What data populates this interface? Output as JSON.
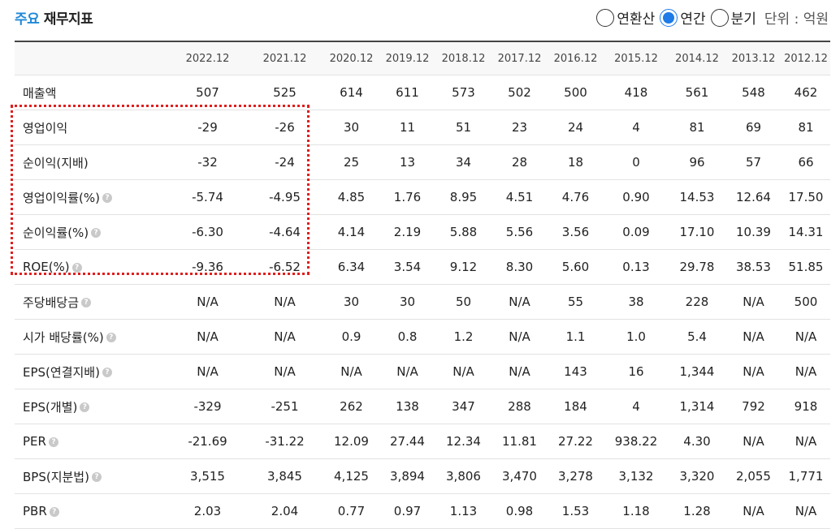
{
  "title": {
    "accent": "주요",
    "main": "재무지표"
  },
  "controls": {
    "options": [
      {
        "label": "연환산",
        "selected": false
      },
      {
        "label": "연간",
        "selected": true
      },
      {
        "label": "분기",
        "selected": false
      }
    ],
    "unit": "단위 : 억원"
  },
  "colors": {
    "accent": "#1e88d8",
    "radio_selected": "#1e7be8",
    "highlight": "#e01e1e"
  },
  "table": {
    "columns": [
      "2022.12",
      "2021.12",
      "2020.12",
      "2019.12",
      "2018.12",
      "2017.12",
      "2016.12",
      "2015.12",
      "2014.12",
      "2013.12",
      "2012.12"
    ],
    "rows": [
      {
        "label": "매출액",
        "help": false,
        "values": [
          "507",
          "525",
          "614",
          "611",
          "573",
          "502",
          "500",
          "418",
          "561",
          "548",
          "462"
        ]
      },
      {
        "label": "영업이익",
        "help": false,
        "values": [
          "-29",
          "-26",
          "30",
          "11",
          "51",
          "23",
          "24",
          "4",
          "81",
          "69",
          "81"
        ]
      },
      {
        "label": "순이익(지배)",
        "help": false,
        "values": [
          "-32",
          "-24",
          "25",
          "13",
          "34",
          "28",
          "18",
          "0",
          "96",
          "57",
          "66"
        ]
      },
      {
        "label": "영업이익률(%)",
        "help": true,
        "values": [
          "-5.74",
          "-4.95",
          "4.85",
          "1.76",
          "8.95",
          "4.51",
          "4.76",
          "0.90",
          "14.53",
          "12.64",
          "17.50"
        ]
      },
      {
        "label": "순이익률(%)",
        "help": true,
        "values": [
          "-6.30",
          "-4.64",
          "4.14",
          "2.19",
          "5.88",
          "5.56",
          "3.56",
          "0.09",
          "17.10",
          "10.39",
          "14.31"
        ]
      },
      {
        "label": "ROE(%)",
        "help": true,
        "values": [
          "-9.36",
          "-6.52",
          "6.34",
          "3.54",
          "9.12",
          "8.30",
          "5.60",
          "0.13",
          "29.78",
          "38.53",
          "51.85"
        ]
      },
      {
        "label": "주당배당금",
        "help": true,
        "values": [
          "N/A",
          "N/A",
          "30",
          "30",
          "50",
          "N/A",
          "55",
          "38",
          "228",
          "N/A",
          "500"
        ]
      },
      {
        "label": "시가 배당률(%)",
        "help": true,
        "values": [
          "N/A",
          "N/A",
          "0.9",
          "0.8",
          "1.2",
          "N/A",
          "1.1",
          "1.0",
          "5.4",
          "N/A",
          "N/A"
        ]
      },
      {
        "label": "EPS(연결지배)",
        "help": true,
        "values": [
          "N/A",
          "N/A",
          "N/A",
          "N/A",
          "N/A",
          "N/A",
          "143",
          "16",
          "1,344",
          "N/A",
          "N/A"
        ]
      },
      {
        "label": "EPS(개별)",
        "help": true,
        "values": [
          "-329",
          "-251",
          "262",
          "138",
          "347",
          "288",
          "184",
          "4",
          "1,314",
          "792",
          "918"
        ]
      },
      {
        "label": "PER",
        "help": true,
        "values": [
          "-21.69",
          "-31.22",
          "12.09",
          "27.44",
          "12.34",
          "11.81",
          "27.22",
          "938.22",
          "4.30",
          "N/A",
          "N/A"
        ]
      },
      {
        "label": "BPS(지분법)",
        "help": true,
        "values": [
          "3,515",
          "3,845",
          "4,125",
          "3,894",
          "3,806",
          "3,470",
          "3,278",
          "3,132",
          "3,320",
          "2,055",
          "1,771"
        ]
      },
      {
        "label": "PBR",
        "help": true,
        "values": [
          "2.03",
          "2.04",
          "0.77",
          "0.97",
          "1.13",
          "0.98",
          "1.53",
          "1.18",
          "1.28",
          "N/A",
          "N/A"
        ]
      }
    ]
  }
}
